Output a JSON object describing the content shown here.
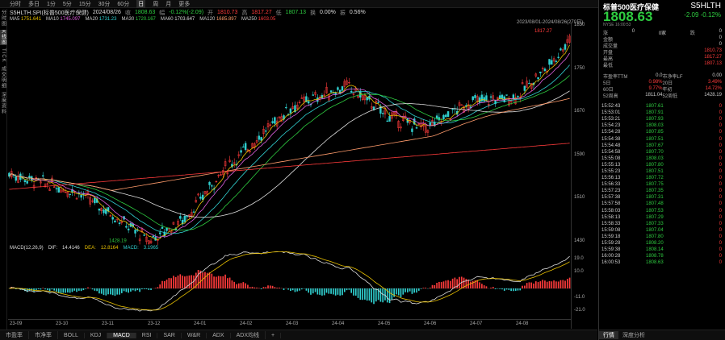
{
  "topbar": {
    "timeframes": [
      "分时",
      "多日",
      "1分",
      "5分",
      "15分",
      "30分",
      "60分",
      "日",
      "周",
      "月",
      "更多"
    ],
    "active_timeframe": "日",
    "tools": [
      "F9",
      "盘口",
      "超级盘口",
      "图线",
      "工具"
    ]
  },
  "left_tabs": [
    "分时图",
    "K线图",
    "TICK",
    "成交明细",
    "深度资料"
  ],
  "info": {
    "symbol": "S5HLTH.SPI(标普500医疗保健)",
    "date": "2024/08/26",
    "close_label": "收",
    "close": "1808.63",
    "change_label": "幅",
    "change": "-0.12%(-2.09)",
    "open_label": "开",
    "open": "1810.73",
    "high_label": "高",
    "high": "1817.27",
    "low_label": "低",
    "low": "1807.13",
    "volume_label": "换",
    "volume": "0.00%",
    "amplitude_label": "振",
    "amplitude": "0.56%",
    "ma": [
      {
        "name": "MA5",
        "value": "1751.641",
        "color": "#e8c000"
      },
      {
        "name": "MA10",
        "value": "1745.097",
        "color": "#e060e0"
      },
      {
        "name": "MA20",
        "value": "1731.23",
        "color": "#30d0d0"
      },
      {
        "name": "MA30",
        "value": "1720.167",
        "color": "#2ecc40"
      },
      {
        "name": "MA60",
        "value": "1703.647",
        "color": "#ddd"
      },
      {
        "name": "MA120",
        "value": "1685.897",
        "color": "#ff9b6b"
      },
      {
        "name": "MA250",
        "value": "1603.05",
        "color": "#ff3b3b"
      }
    ],
    "date_range": "2023/08/01-2024/08/26(270日)"
  },
  "chart": {
    "y_ticks": [
      "1830",
      "1750",
      "1670",
      "1590",
      "1510",
      "1430"
    ],
    "high_label": "1817.27",
    "low_label": "1428.19",
    "macd_ticks": [
      "19.0",
      "10.0",
      "",
      "-11.0",
      "-21.0"
    ],
    "x_labels": [
      "23-09",
      "23-10",
      "23-11",
      "23-12",
      "24-01",
      "24-02",
      "24-03",
      "24-04",
      "24-05",
      "24-06",
      "24-07",
      "24-08"
    ]
  },
  "macd": {
    "label": "MACD(12,26,9)",
    "dif_label": "DIF:",
    "dif": "14.4146",
    "dea_label": "DEA:",
    "dea": "12.8164",
    "macd_label": "MACD:",
    "macd_val": "3.1965"
  },
  "bottom_tabs": [
    "市盈率",
    "市净率",
    "BOLL",
    "KDJ",
    "MACD",
    "RSI",
    "SAR",
    "W&R",
    "ADX",
    "ADX均线",
    "+"
  ],
  "active_bottom_tab": "MACD",
  "quote": {
    "name": "标普500医疗保健",
    "code": "S5HLTH",
    "price": "1808.63",
    "change": "-2.09  -0.12%",
    "time": "NYSE 16:00:53",
    "kv": [
      {
        "k": "涨",
        "v": "0",
        "k2": "0家",
        "v2": "跌",
        "v3": "0"
      },
      {
        "k": "金额",
        "v": "0"
      },
      {
        "k": "成交量",
        "v": "0"
      },
      {
        "k": "开盘",
        "v": "1810.73"
      },
      {
        "k": "最高",
        "v": "1817.27"
      },
      {
        "k": "最低",
        "v": "1807.13"
      }
    ],
    "stats": [
      [
        "市盈率TTM",
        "0.0",
        "市净率LF",
        "0.00"
      ],
      [
        "5日",
        "0.98%",
        "20日",
        "3.49%"
      ],
      [
        "60日",
        "9.77%",
        "年初",
        "14.72%"
      ],
      [
        "52周高",
        "1811.04",
        "52周低",
        "1428.19"
      ]
    ],
    "ticks": [
      [
        "15:52:43",
        "1807.61",
        "0"
      ],
      [
        "15:53:01",
        "1807.91",
        "0"
      ],
      [
        "15:53:21",
        "1807.93",
        "0"
      ],
      [
        "15:54:23",
        "1808.03",
        "0"
      ],
      [
        "15:54:28",
        "1807.85",
        "0"
      ],
      [
        "15:54:38",
        "1807.51",
        "0"
      ],
      [
        "15:54:48",
        "1807.67",
        "0"
      ],
      [
        "15:54:58",
        "1807.70",
        "0"
      ],
      [
        "15:55:08",
        "1808.03",
        "0"
      ],
      [
        "15:55:13",
        "1807.80",
        "0"
      ],
      [
        "15:55:23",
        "1807.51",
        "0"
      ],
      [
        "15:56:13",
        "1807.72",
        "0"
      ],
      [
        "15:56:33",
        "1807.75",
        "0"
      ],
      [
        "15:57:23",
        "1807.35",
        "0"
      ],
      [
        "15:57:38",
        "1807.31",
        "0"
      ],
      [
        "15:57:58",
        "1807.48",
        "0"
      ],
      [
        "15:58:03",
        "1807.53",
        "0"
      ],
      [
        "15:58:13",
        "1807.29",
        "0"
      ],
      [
        "15:58:33",
        "1807.33",
        "0"
      ],
      [
        "15:59:08",
        "1807.04",
        "0"
      ],
      [
        "15:59:18",
        "1807.80",
        "0"
      ],
      [
        "15:59:28",
        "1808.20",
        "0"
      ],
      [
        "15:59:38",
        "1808.14",
        "0"
      ],
      [
        "16:00:28",
        "1808.78",
        "0"
      ],
      [
        "16:00:53",
        "1808.63",
        "0"
      ]
    ],
    "tabs": [
      "行情",
      "深度分析"
    ]
  }
}
